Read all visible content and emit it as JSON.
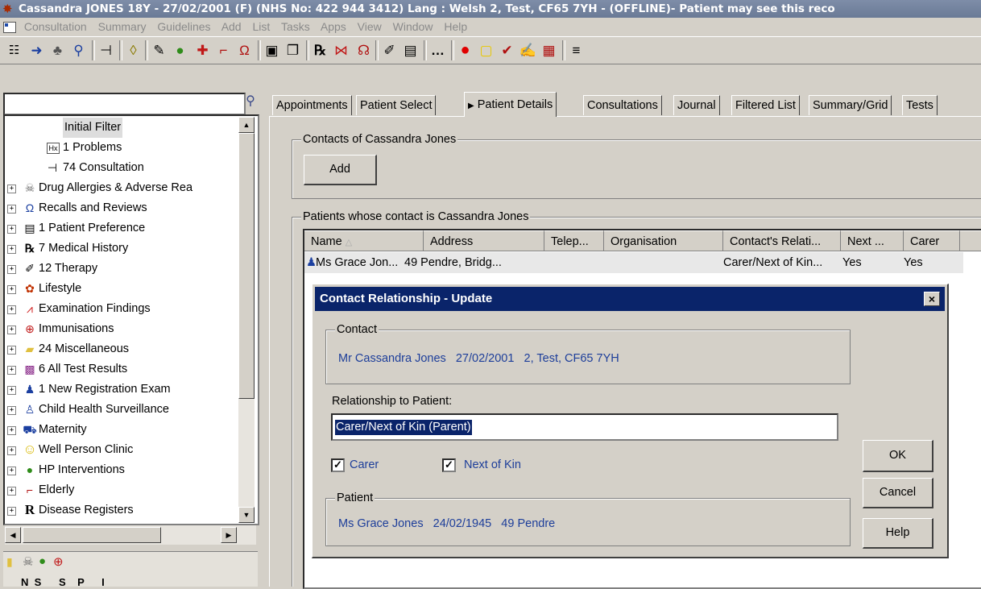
{
  "window": {
    "title": "Cassandra JONES 18Y - 27/02/2001 (F) (NHS No: 422 944 3412) Lang : Welsh  2, Test, CF65 7YH - (OFFLINE)- Patient may see this reco"
  },
  "menu": [
    "Consultation",
    "Summary",
    "Guidelines",
    "Add",
    "List",
    "Tasks",
    "Apps",
    "View",
    "Window",
    "Help"
  ],
  "toolbar_icons": [
    "list-icon",
    "patient-find-icon",
    "patient-group-icon",
    "search-icon",
    "consultation-icon",
    "eraser-icon",
    "notes-icon",
    "apple-icon",
    "medical-cross-icon",
    "walking-stick-icon",
    "reviews-icon",
    "calculator-icon",
    "copy-icon",
    "rx-icon",
    "examination-icon",
    "speech-icon",
    "pen-icon",
    "document-icon",
    "more-icon",
    "record-icon",
    "message-icon",
    "check-icon",
    "edit-icon",
    "calendar-icon",
    "menu-icon"
  ],
  "tree": {
    "items": [
      {
        "label": "Initial Filter",
        "icon": "none"
      },
      {
        "label": "1 Problems",
        "icon": "problems-icon"
      },
      {
        "label": "74 Consultation",
        "icon": "consultation-icon"
      },
      {
        "label": "Drug Allergies & Adverse Rea",
        "icon": "allergy-icon"
      },
      {
        "label": "Recalls and Reviews",
        "icon": "recall-icon"
      },
      {
        "label": "1 Patient Preference",
        "icon": "document-icon"
      },
      {
        "label": "7 Medical History",
        "icon": "rx-icon"
      },
      {
        "label": "12 Therapy",
        "icon": "pen-icon"
      },
      {
        "label": "Lifestyle",
        "icon": "lifestyle-icon"
      },
      {
        "label": "Examination Findings",
        "icon": "examination-icon"
      },
      {
        "label": "Immunisations",
        "icon": "immunisation-icon"
      },
      {
        "label": "24 Miscellaneous",
        "icon": "folder-icon"
      },
      {
        "label": "6 All Test Results",
        "icon": "test-results-icon"
      },
      {
        "label": "1 New Registration Exam",
        "icon": "patient-icon"
      },
      {
        "label": "Child Health Surveillance",
        "icon": "child-health-icon"
      },
      {
        "label": "Maternity",
        "icon": "pram-icon"
      },
      {
        "label": "Well Person Clinic",
        "icon": "smiley-icon"
      },
      {
        "label": "HP Interventions",
        "icon": "apple-icon"
      },
      {
        "label": "Elderly",
        "icon": "walking-stick-icon"
      },
      {
        "label": "Disease Registers",
        "icon": "register-icon"
      }
    ]
  },
  "lower_panel": {
    "headings_partial": "N  S      S    P      I"
  },
  "tabs": [
    {
      "label": "Appointments"
    },
    {
      "label": "Patient Select"
    },
    {
      "label": "Patient Details"
    },
    {
      "label": "Consultations"
    },
    {
      "label": "Journal"
    },
    {
      "label": "Filtered List"
    },
    {
      "label": "Summary/Grid"
    },
    {
      "label": "Tests"
    }
  ],
  "contacts_group": {
    "label": "Contacts of Cassandra Jones",
    "add_button": "Add"
  },
  "patients_group": {
    "label": "Patients whose contact is Cassandra Jones"
  },
  "list": {
    "columns": [
      "Name",
      "Address",
      "Telep...",
      "Organisation",
      "Contact's Relati...",
      "Next ...",
      "Carer"
    ],
    "rows": [
      {
        "name": "Ms Grace Jon...",
        "address": "49 Pendre, Bridg...",
        "telephone": "",
        "organisation": "",
        "relationship": "Carer/Next of Kin...",
        "next": "Yes",
        "carer": "Yes"
      }
    ]
  },
  "dialog": {
    "title": "Contact Relationship - Update",
    "close": "×",
    "contact_label": "Contact",
    "contact_text": "Mr Cassandra Jones   27/02/2001   2, Test, CF65 7YH",
    "relationship_label": "Relationship to Patient:",
    "relationship_value": "Carer/Next of Kin (Parent)",
    "carer_label": "Carer",
    "carer_checked": true,
    "nok_label": "Next of Kin",
    "nok_checked": true,
    "patient_label": "Patient",
    "patient_text": "Ms Grace Jones   24/02/1945   49 Pendre",
    "ok": "OK",
    "cancel": "Cancel",
    "help": "Help"
  },
  "colors": {
    "dialog_title_bg": "#0a246a",
    "blue_text": "#1d3e9a",
    "selection": "#0a246a"
  }
}
